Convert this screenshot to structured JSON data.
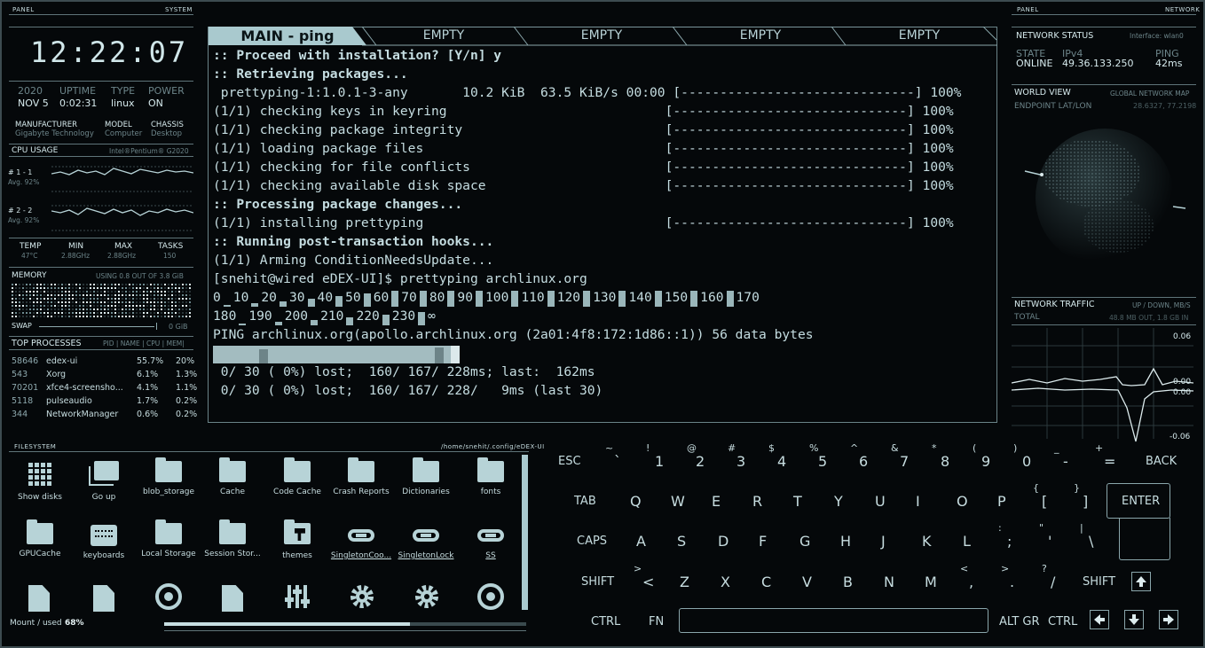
{
  "left_panel": {
    "header_left": "PANEL",
    "header_right": "SYSTEM",
    "clock": "12:22:07",
    "info": {
      "year": "2020",
      "date": "NOV 5",
      "uptime_label": "UPTIME",
      "uptime": "0:02:31",
      "type_label": "TYPE",
      "type": "linux",
      "power_label": "POWER",
      "power": "ON"
    },
    "hw": {
      "manufacturer_label": "MANUFACTURER",
      "manufacturer": "Gigabyte Technology",
      "model_label": "MODEL",
      "model": "Computer",
      "chassis_label": "CHASSIS",
      "chassis": "Desktop"
    },
    "cpu": {
      "title": "CPU USAGE",
      "model": "Intel®Pentium® G2020",
      "core1": "# 1 - 1",
      "core1_avg": "Avg. 92%",
      "core2": "# 2 - 2",
      "core2_avg": "Avg. 92%"
    },
    "stats": {
      "temp_label": "TEMP",
      "temp": "47°C",
      "min_label": "MIN",
      "min": "2.88GHz",
      "max_label": "MAX",
      "max": "2.88GHz",
      "tasks_label": "TASKS",
      "tasks": "150"
    },
    "memory": {
      "title": "MEMORY",
      "usage": "USING 0.8 OUT OF 3.8 GiB",
      "swap_label": "SWAP",
      "swap_value": "0 GiB"
    },
    "processes": {
      "title": "TOP PROCESSES",
      "columns": "PID | NAME | CPU | MEM|",
      "rows": [
        {
          "pid": "58646",
          "name": "edex-ui",
          "cpu": "55.7%",
          "mem": "20%"
        },
        {
          "pid": "543",
          "name": "Xorg",
          "cpu": "6.1%",
          "mem": "1.3%"
        },
        {
          "pid": "70201",
          "name": "xfce4-screensho...",
          "cpu": "4.1%",
          "mem": "1.1%"
        },
        {
          "pid": "5118",
          "name": "pulseaudio",
          "cpu": "1.7%",
          "mem": "0.2%"
        },
        {
          "pid": "344",
          "name": "NetworkManager",
          "cpu": "0.6%",
          "mem": "0.2%"
        }
      ]
    }
  },
  "terminal": {
    "tabs": [
      "MAIN - ping",
      "EMPTY",
      "EMPTY",
      "EMPTY",
      "EMPTY"
    ],
    "lines": {
      "l1": ":: Proceed with installation? [Y/n] y",
      "l2": ":: Retrieving packages...",
      "l3": " prettyping-1:1.0.1-3-any       10.2 KiB  63.5 KiB/s 00:00 [------------------------------] 100%",
      "l4": "(1/1) checking keys in keyring                            [------------------------------] 100%",
      "l5": "(1/1) checking package integrity                          [------------------------------] 100%",
      "l6": "(1/1) loading package files                               [------------------------------] 100%",
      "l7": "(1/1) checking for file conflicts                         [------------------------------] 100%",
      "l8": "(1/1) checking available disk space                       [------------------------------] 100%",
      "l9": ":: Processing package changes...",
      "l10": "(1/1) installing prettyping                               [------------------------------] 100%",
      "l11": ":: Running post-transaction hooks...",
      "l12": "(1/1) Arming ConditionNeedsUpdate...",
      "l13": "[snehit@wired eDEX-UI]$ prettyping archlinux.org",
      "l16": "PING archlinux.org(apollo.archlinux.org (2a01:4f8:172:1d86::1)) 56 data bytes",
      "l18": " 0/ 30 ( 0%) lost;  160/ 167/ 228ms; last:  162ms",
      "l19": " 0/ 30 ( 0%) lost;  160/ 167/ 228/   9ms (last 30)"
    },
    "scale1": [
      "0",
      "10",
      "20",
      "30",
      "40",
      "50",
      "60",
      "70",
      "80",
      "90",
      "100",
      "110",
      "120",
      "130",
      "140",
      "150",
      "160",
      "170"
    ],
    "scale2": [
      "180",
      "190",
      "200",
      "210",
      "220",
      "230",
      "∞"
    ]
  },
  "right_panel": {
    "header_left": "PANEL",
    "header_right": "NETWORK",
    "status": {
      "title": "NETWORK STATUS",
      "iface": "Interface: wlan0",
      "state_label": "STATE",
      "state": "ONLINE",
      "ip_label": "IPv4",
      "ip": "49.36.133.250",
      "ping_label": "PING",
      "ping": "42ms"
    },
    "world": {
      "title": "WORLD VIEW",
      "subtitle": "GLOBAL NETWORK MAP",
      "endpoint_label": "ENDPOINT LAT/LON",
      "endpoint": "28.6327, 77.2198"
    },
    "traffic": {
      "title": "NETWORK TRAFFIC",
      "subtitle": "UP / DOWN, MB/S",
      "total_label": "TOTAL",
      "total": "48.8 MB OUT, 1.8 GB IN",
      "y_top": "0.06",
      "y_mid1": "0.00",
      "y_mid2": "0.00",
      "y_bot": "-0.06"
    }
  },
  "filesystem": {
    "title": "FILESYSTEM",
    "path": "/home/snehit/.config/eDEX-UI",
    "items": [
      {
        "label": "Show disks"
      },
      {
        "label": "Go up"
      },
      {
        "label": "blob_storage"
      },
      {
        "label": "Cache"
      },
      {
        "label": "Code Cache"
      },
      {
        "label": "Crash Reports"
      },
      {
        "label": "Dictionaries"
      },
      {
        "label": "fonts"
      },
      {
        "label": "GPUCache"
      },
      {
        "label": "keyboards"
      },
      {
        "label": "Local Storage"
      },
      {
        "label": "Session Stor..."
      },
      {
        "label": "themes"
      },
      {
        "label": "SingletonCoo..."
      },
      {
        "label": "SingletonLock"
      },
      {
        "label": "SS"
      }
    ],
    "mount_label": "Mount / used",
    "mount_value": "68%"
  },
  "keyboard": {
    "esc": "ESC",
    "back": "BACK",
    "tab": "TAB",
    "enter": "ENTER",
    "caps": "CAPS",
    "shift": "SHIFT",
    "shift_r": "SHIFT",
    "ctrl": "CTRL",
    "fn": "FN",
    "altgr": "ALT GR",
    "ctrl_r": "CTRL",
    "row1": [
      [
        "~",
        "`"
      ],
      [
        "!",
        "1"
      ],
      [
        "@",
        "2"
      ],
      [
        "#",
        "3"
      ],
      [
        "$",
        "4"
      ],
      [
        "%",
        "5"
      ],
      [
        "^",
        "6"
      ],
      [
        "&",
        "7"
      ],
      [
        "*",
        "8"
      ],
      [
        "(",
        "9"
      ],
      [
        ")",
        "0"
      ],
      [
        "_",
        "-"
      ],
      [
        "+",
        "="
      ]
    ],
    "row2": [
      "Q",
      "W",
      "E",
      "R",
      "T",
      "Y",
      "U",
      "I",
      "O",
      "P",
      [
        "{",
        "["
      ],
      [
        "}",
        "]"
      ]
    ],
    "row3": [
      "A",
      "S",
      "D",
      "F",
      "G",
      "H",
      "J",
      "K",
      "L",
      [
        ":",
        ";"
      ],
      [
        "\"",
        "'"
      ],
      [
        "|",
        "\\"
      ]
    ],
    "row4": [
      [
        ">",
        "<"
      ],
      "Z",
      "X",
      "C",
      "V",
      "B",
      "N",
      "M",
      [
        "<",
        ","
      ],
      [
        ">",
        "."
      ],
      [
        "?",
        "/"
      ]
    ]
  }
}
